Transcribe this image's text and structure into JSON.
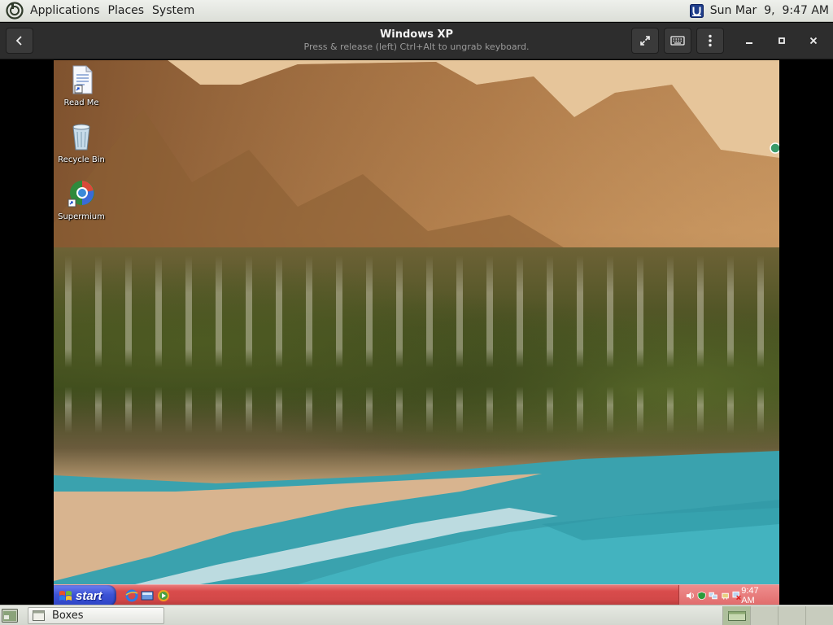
{
  "top_panel": {
    "menus": [
      "Applications",
      "Places",
      "System"
    ],
    "clock": "Sun Mar  9,  9:47 AM",
    "tray_icon": "update-notifier-icon"
  },
  "window": {
    "title": "Windows XP",
    "subtitle": "Press & release (left) Ctrl+Alt to ungrab keyboard.",
    "buttons": [
      "back-icon",
      "fullscreen-icon",
      "keyboard-icon",
      "menu-icon",
      "minimize-icon",
      "maximize-icon",
      "close-icon"
    ]
  },
  "vm": {
    "desktop_icons": [
      {
        "label": "Read Me",
        "icon": "document-icon"
      },
      {
        "label": "Recycle Bin",
        "icon": "recycle-bin-icon"
      },
      {
        "label": "Supermium",
        "icon": "browser-icon"
      }
    ],
    "taskbar": {
      "start_label": "start",
      "quick_launch": [
        "internet-explorer-icon",
        "show-desktop-icon",
        "media-player-icon"
      ],
      "tray_icons": [
        "volume-icon",
        "security-icon",
        "network-icon",
        "safely-remove-icon",
        "network-disconnected-icon"
      ],
      "time": "9:47 AM",
      "colors": {
        "taskbar": "#d94c4c",
        "start": "#3c53d6",
        "tray": "#e06a6a"
      }
    }
  },
  "bottom_panel": {
    "task_label": "Boxes",
    "workspaces": 4,
    "active_workspace": 1
  }
}
